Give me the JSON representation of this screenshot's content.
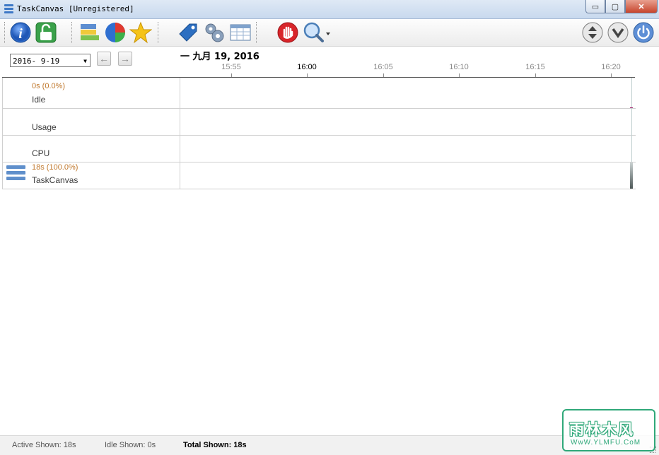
{
  "window": {
    "title": "TaskCanvas [Unregistered]",
    "buttons": {
      "minimize": "▭",
      "maximize": "▢",
      "close": "✕"
    }
  },
  "toolbar": {
    "left_icons": [
      "info-icon",
      "unlock-icon",
      "stacked-bars-icon",
      "pie-chart-icon",
      "star-icon",
      "tag-icon",
      "gear-icon",
      "calendar-table-icon",
      "stop-hand-icon",
      "magnifier-icon"
    ],
    "right_icons": [
      "sort-updown-icon",
      "collapse-down-icon",
      "power-icon"
    ]
  },
  "date": {
    "selected": "2016- 9-19",
    "heading": "一 九月 19, 2016",
    "prev_glyph": "←",
    "next_glyph": "→"
  },
  "timeline": {
    "ticks": [
      {
        "label": "15:55",
        "major": false
      },
      {
        "label": "16:00",
        "major": true
      },
      {
        "label": "16:05",
        "major": false
      },
      {
        "label": "16:10",
        "major": false
      },
      {
        "label": "16:15",
        "major": false
      },
      {
        "label": "16:20",
        "major": false
      }
    ]
  },
  "rows": [
    {
      "sub": "0s (0.0%)",
      "label": "Idle"
    },
    {
      "sub": "",
      "label": "Usage"
    },
    {
      "sub": "",
      "label": "CPU"
    },
    {
      "sub": "18s (100.0%)",
      "label": "TaskCanvas",
      "icon": "app-list-icon"
    }
  ],
  "status": {
    "active": "Active Shown: 18s",
    "idle": "Idle Shown: 0s",
    "total": "Total Shown: 18s"
  },
  "watermark": {
    "main": "雨林木风",
    "sub": "WwW.YLMFU.CoM",
    "color": "#2fa879"
  }
}
